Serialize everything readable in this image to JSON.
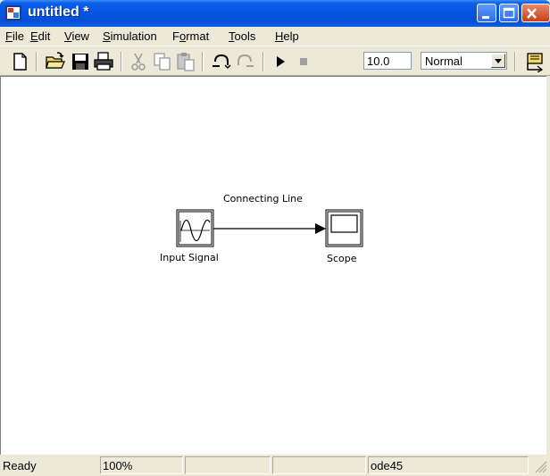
{
  "window": {
    "title": "untitled *",
    "minimize_icon": "minimize-icon",
    "maximize_icon": "maximize-icon",
    "close_icon": "close-icon"
  },
  "menu": {
    "items": [
      {
        "mnemonic": "F",
        "rest": "ile"
      },
      {
        "mnemonic": "E",
        "rest": "dit"
      },
      {
        "mnemonic": "V",
        "rest": "iew"
      },
      {
        "mnemonic": "S",
        "rest": "imulation"
      },
      {
        "pre": "F",
        "mnemonic": "o",
        "rest": "rmat"
      },
      {
        "mnemonic": "T",
        "rest": "ools"
      },
      {
        "mnemonic": "H",
        "rest": "elp"
      }
    ]
  },
  "toolbar": {
    "icons": [
      "new-model-icon",
      "open-icon",
      "save-icon",
      "print-icon",
      "cut-icon",
      "copy-icon",
      "paste-icon",
      "undo-icon",
      "redo-icon",
      "start-simulation-icon",
      "stop-simulation-icon",
      "build-icon"
    ],
    "stop_time": "10.0",
    "simulation_mode": "Normal"
  },
  "diagram": {
    "source_block_label": "Input Signal",
    "sink_block_label": "Scope",
    "line_label": "Connecting Line"
  },
  "status": {
    "state": "Ready",
    "zoom": "100%",
    "cell3": "",
    "cell4": "",
    "solver": "ode45"
  },
  "colors": {
    "titlebar": "#0553e0",
    "chrome": "#ece9d8",
    "canvas": "#ffffff"
  }
}
